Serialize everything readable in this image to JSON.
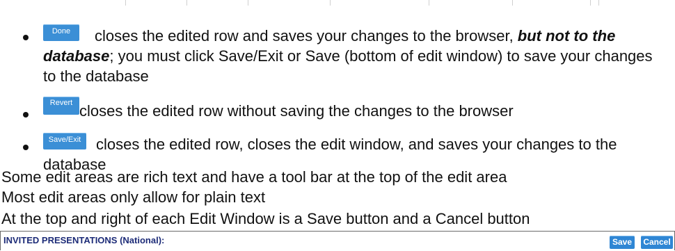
{
  "bullets": [
    {
      "button_label": "Done",
      "text_before_emphasis": "closes the edited row and saves your changes to the browser, ",
      "emphasis": "but not to the database",
      "text_after_emphasis": "; you must click Save/Exit or Save (bottom of edit window) to save your changes to the database"
    },
    {
      "button_label": "Revert",
      "text": "closes the edited row without saving the changes to the browser"
    },
    {
      "button_label": "Save/Exit",
      "text": "closes the edited row, closes the edit window, and saves your changes to the database"
    }
  ],
  "lines": [
    "Some edit areas are rich text and have a tool bar at the top of the edit area",
    "Most edit areas only allow for plain text",
    "At the top and right of each Edit Window is a Save button and a Cancel button"
  ],
  "panel": {
    "title": "INVITED PRESENTATIONS (National):",
    "save_label": "Save",
    "cancel_label": "Cancel"
  },
  "colors": {
    "button_blue": "#3b8fd6",
    "panel_title": "#1d2c78"
  }
}
